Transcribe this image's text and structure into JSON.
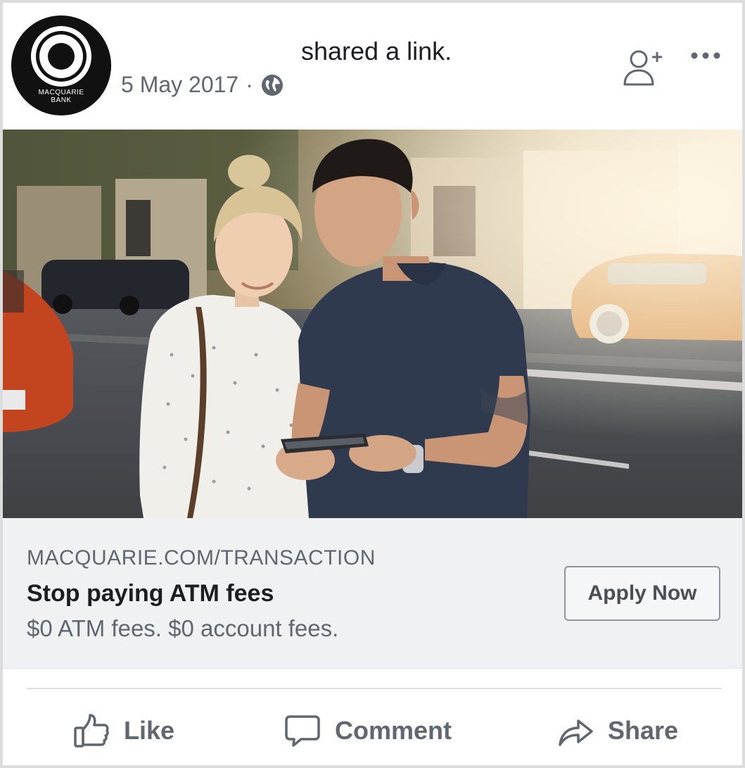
{
  "post": {
    "page_logo_text_line1": "MACQUARIE",
    "page_logo_text_line2": "BANK",
    "action_text": "shared a link.",
    "date": "5 May 2017",
    "separator": "·",
    "privacy_icon": "globe-icon",
    "add_friend_icon": "add-friend-icon",
    "more_icon": "more-options-icon"
  },
  "link": {
    "domain": "MACQUARIE.COM/TRANSACTION",
    "title": "Stop paying ATM fees",
    "description": "$0 ATM fees. $0 account fees.",
    "cta_label": "Apply Now"
  },
  "actions": {
    "like_label": "Like",
    "comment_label": "Comment",
    "share_label": "Share",
    "like_icon": "thumbs-up-icon",
    "comment_icon": "speech-bubble-icon",
    "share_icon": "share-arrow-icon"
  },
  "colors": {
    "text_primary": "#1c1e21",
    "text_secondary": "#606770",
    "preview_bg": "#f0f1f3",
    "border": "#dcdcdc"
  }
}
